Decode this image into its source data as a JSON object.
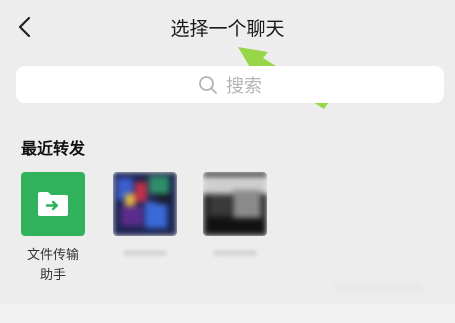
{
  "header": {
    "title": "选择一个聊天",
    "back_icon": "chevron-left-icon"
  },
  "search": {
    "placeholder": "搜索",
    "icon": "search-icon"
  },
  "recent": {
    "heading": "最近转发",
    "items": [
      {
        "label_line1": "文件传输",
        "label_line2": "助手",
        "icon": "folder-forward-icon",
        "color": "#2fb25b"
      },
      {
        "label_line1": "",
        "label_line2": ""
      },
      {
        "label_line1": "",
        "label_line2": ""
      }
    ]
  },
  "colors": {
    "background": "#ededed",
    "accent_green": "#2fb25b",
    "arrow_green": "#8ed43a"
  }
}
